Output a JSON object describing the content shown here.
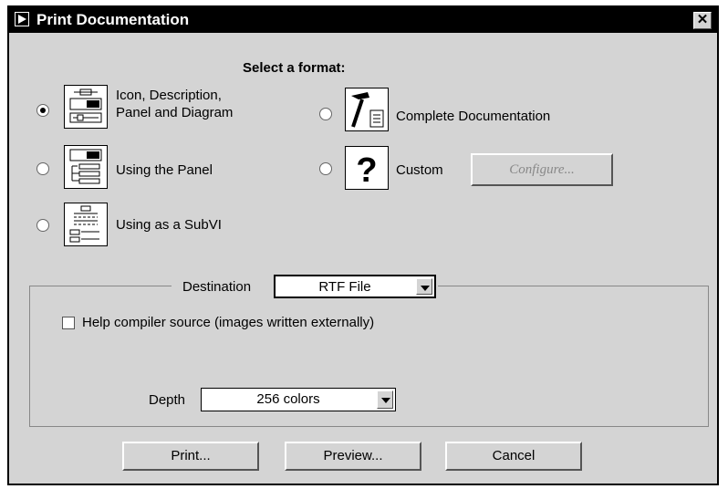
{
  "window": {
    "title": "Print Documentation",
    "close_label": "✕"
  },
  "format": {
    "heading": "Select a format:",
    "options": [
      {
        "label_line1": "Icon, Description,",
        "label_line2": "Panel and Diagram",
        "selected": true
      },
      {
        "label": "Using the Panel",
        "selected": false
      },
      {
        "label": "Using as a SubVI",
        "selected": false
      },
      {
        "label": "Complete Documentation",
        "selected": false
      },
      {
        "label": "Custom",
        "selected": false
      }
    ],
    "configure_label": "Configure..."
  },
  "destination": {
    "label": "Destination",
    "value": "RTF File",
    "help_compiler_label": "Help compiler source (images written externally)",
    "help_compiler_checked": false,
    "depth_label": "Depth",
    "depth_value": "256 colors"
  },
  "buttons": {
    "print": "Print...",
    "preview": "Preview...",
    "cancel": "Cancel"
  }
}
